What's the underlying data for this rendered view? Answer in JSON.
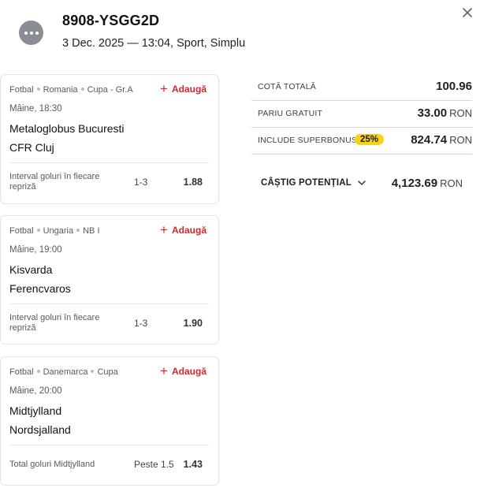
{
  "header": {
    "ticket_id": "8908-YSGG2D",
    "meta": "3 Dec. 2025 — 13:04, Sport, Simplu"
  },
  "add_label": "Adaugă",
  "events": [
    {
      "sport": "Fotbal",
      "country": "Romania",
      "competition": "Cupa - Gr.A",
      "time": "Mâine, 18:30",
      "home": "Metaloglobus Bucuresti",
      "away": "CFR Cluj",
      "market": "Interval goluri în fiecare repriză",
      "selection": "1-3",
      "odds": "1.88"
    },
    {
      "sport": "Fotbal",
      "country": "Ungaria",
      "competition": "NB I",
      "time": "Mâine, 19:00",
      "home": "Kisvarda",
      "away": "Ferencvaros",
      "market": "Interval goluri în fiecare repriză",
      "selection": "1-3",
      "odds": "1.90"
    },
    {
      "sport": "Fotbal",
      "country": "Danemarca",
      "competition": "Cupa",
      "time": "Mâine, 20:00",
      "home": "Midtjylland",
      "away": "Nordsjalland",
      "market": "Total goluri Midtjylland",
      "selection": "Peste 1.5",
      "odds": "1.43"
    }
  ],
  "summary": {
    "total_odds_label": "COTĂ TOTALĂ",
    "total_odds": "100.96",
    "free_bet_label": "PARIU GRATUIT",
    "free_bet": "33.00",
    "superbonus_label": "INCLUDE SUPERBONUS",
    "superbonus_pct": "25%",
    "superbonus": "824.74",
    "currency": "RON",
    "potential_label": "CÂȘTIG POTENȚIAL",
    "potential": "4,123.69"
  },
  "colors": {
    "accent_red": "#d6242b",
    "badge_yellow": "#f7d21a",
    "avatar_gray": "#8a8d93"
  },
  "icons": [
    "more-dots-icon",
    "close-icon",
    "plus-icon",
    "chevron-down-icon"
  ]
}
